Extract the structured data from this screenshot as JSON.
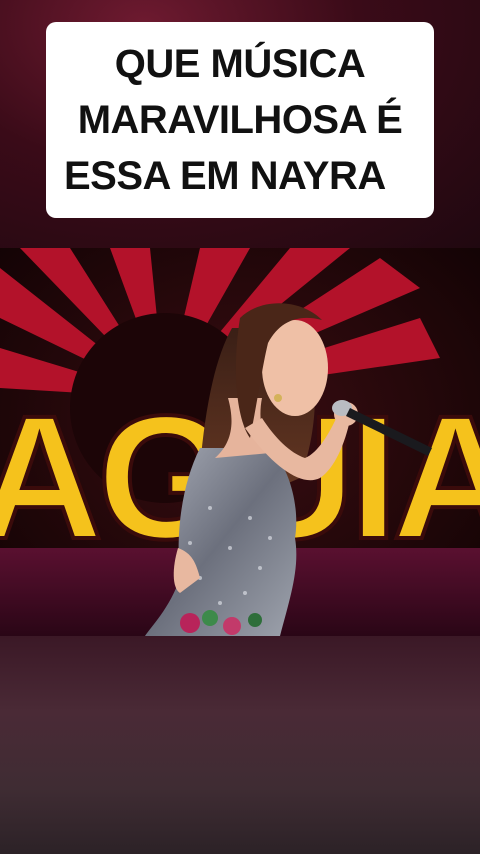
{
  "caption": {
    "lines": [
      "QUE MÚSICA",
      "MARAVILHOSA É",
      "ESSA EM NAYRA"
    ]
  },
  "video": {
    "backdrop_text": "AGUIA",
    "colors": {
      "backdrop_red": "#b3122a",
      "logo_yellow": "#f5c21c",
      "dress_silver": "#8a8e9c"
    }
  }
}
